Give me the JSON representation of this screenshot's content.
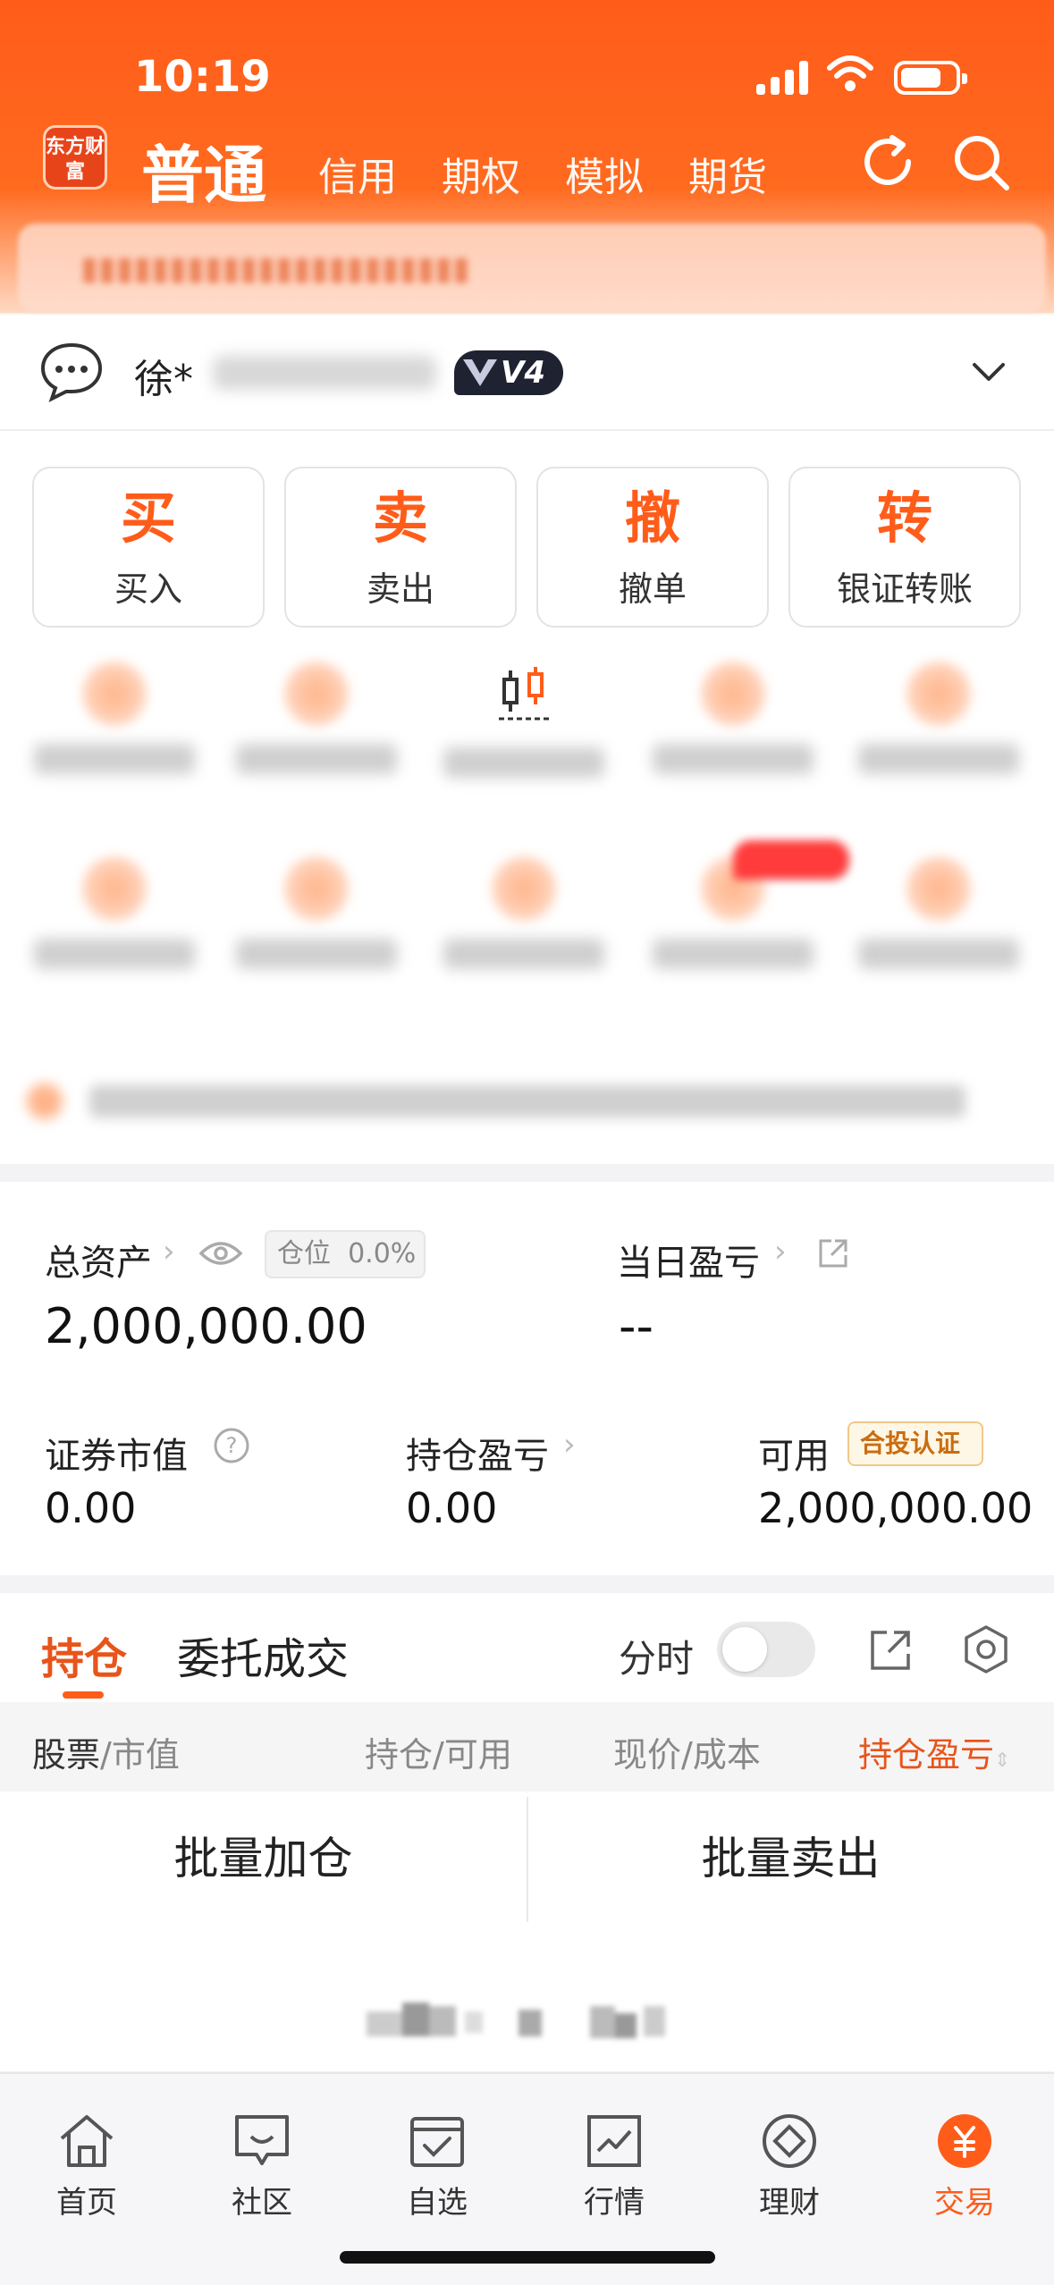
{
  "status_bar": {
    "time": "10:19"
  },
  "header": {
    "logo_text": "东方财富",
    "tabs": [
      {
        "label": "普通",
        "active": true
      },
      {
        "label": "信用"
      },
      {
        "label": "期权"
      },
      {
        "label": "模拟"
      },
      {
        "label": "期货"
      }
    ]
  },
  "account": {
    "name": "徐*",
    "level_badge": "V4"
  },
  "actions": [
    {
      "glyph": "买",
      "label": "买入"
    },
    {
      "glyph": "卖",
      "label": "卖出"
    },
    {
      "glyph": "撤",
      "label": "撤单"
    },
    {
      "glyph": "转",
      "label": "银证转账"
    }
  ],
  "assets": {
    "total_label": "总资产",
    "position_label": "仓位",
    "position_value": "0.0%",
    "total_value": "2,000,000.00",
    "daily_pl_label": "当日盈亏",
    "daily_pl_value": "--",
    "market_value_label": "证券市值",
    "market_value": "0.00",
    "holding_pl_label": "持仓盈亏",
    "holding_pl": "0.00",
    "available_label": "可用",
    "available_badge": "合投认证",
    "available_value": "2,000,000.00"
  },
  "holdings": {
    "tab_active": "持仓",
    "tab_other": "委托成交",
    "fenshi_label": "分时",
    "columns": [
      {
        "name": "股票",
        "sub": "市值"
      },
      {
        "name": "持仓",
        "sub": "可用"
      },
      {
        "name": "现价",
        "sub": "成本"
      },
      {
        "name": "持仓盈亏"
      }
    ],
    "batch_add": "批量加仓",
    "batch_sell": "批量卖出"
  },
  "nav": [
    {
      "label": "首页",
      "icon": "home-icon"
    },
    {
      "label": "社区",
      "icon": "community-icon"
    },
    {
      "label": "自选",
      "icon": "watchlist-icon"
    },
    {
      "label": "行情",
      "icon": "market-icon"
    },
    {
      "label": "理财",
      "icon": "wealth-icon"
    },
    {
      "label": "交易",
      "icon": "trade-icon",
      "active": true
    }
  ],
  "colors": {
    "accent": "#ff5c1a",
    "text": "#222222",
    "muted": "#888888"
  }
}
